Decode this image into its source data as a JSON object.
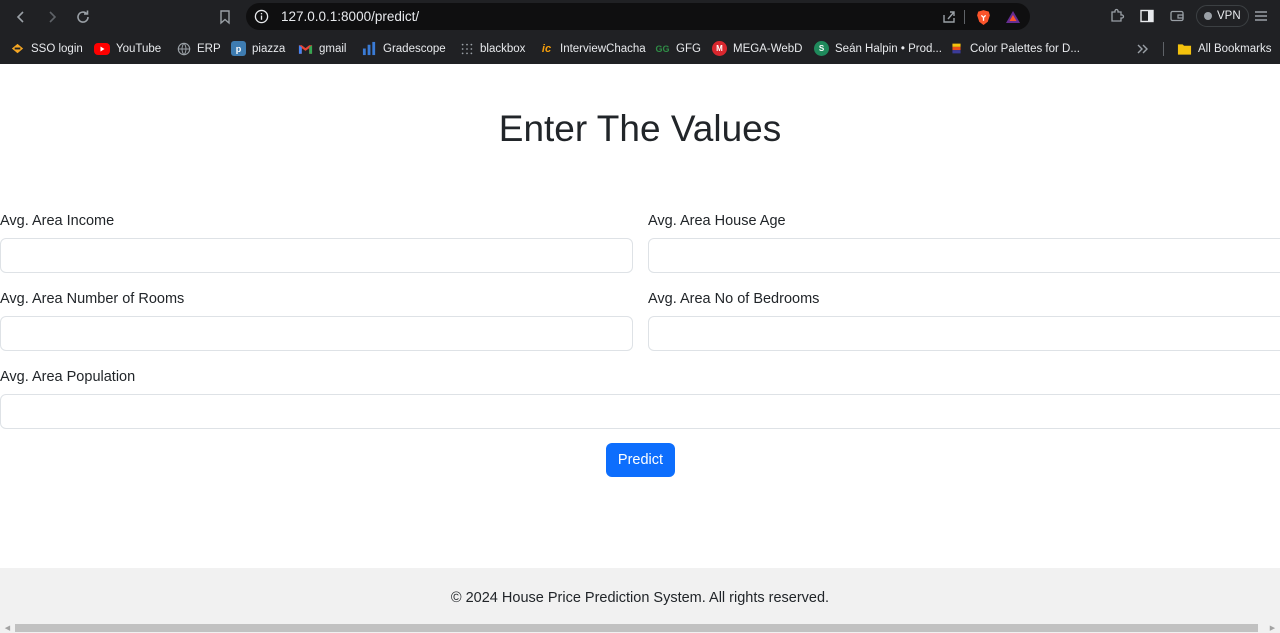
{
  "browser": {
    "url": "127.0.0.1:8000/predict/",
    "vpn_label": "VPN",
    "bookmarks": [
      {
        "label": "SSO login",
        "icon": "sso-icon",
        "color": "#f5a623"
      },
      {
        "label": "YouTube",
        "icon": "youtube-icon",
        "color": "#ff0000"
      },
      {
        "label": "ERP",
        "icon": "globe-icon",
        "color": "#9aa0a6"
      },
      {
        "label": "piazza",
        "icon": "piazza-icon",
        "color": "#3e7cb1"
      },
      {
        "label": "gmail",
        "icon": "gmail-icon",
        "color": "#ea4335"
      },
      {
        "label": "Gradescope",
        "icon": "gradescope-icon",
        "color": "#3a7bd5"
      },
      {
        "label": "blackbox",
        "icon": "blackbox-icon",
        "color": "#9aa0a6"
      },
      {
        "label": "InterviewChacha",
        "icon": "interviewchacha-icon",
        "color": "#f59e0b"
      },
      {
        "label": "GFG",
        "icon": "gfg-icon",
        "color": "#2f8d46"
      },
      {
        "label": "MEGA-WebD",
        "icon": "mega-icon",
        "color": "#d9272e"
      },
      {
        "label": "Seán Halpin • Prod...",
        "icon": "s-icon",
        "color": "#1f8a5c"
      },
      {
        "label": "Color Palettes for D...",
        "icon": "palette-icon",
        "color": "#f4c20d"
      }
    ],
    "all_bookmarks": "All Bookmarks"
  },
  "page": {
    "title": "Enter The Values",
    "fields": {
      "income": {
        "label": "Avg. Area Income",
        "value": ""
      },
      "house_age": {
        "label": "Avg. Area House Age",
        "value": ""
      },
      "rooms": {
        "label": "Avg. Area Number of Rooms",
        "value": ""
      },
      "bedrooms": {
        "label": "Avg. Area No of Bedrooms",
        "value": ""
      },
      "population": {
        "label": "Avg. Area Population",
        "value": ""
      }
    },
    "submit_label": "Predict",
    "footer": "© 2024 House Price Prediction System. All rights reserved."
  },
  "colors": {
    "primary": "#0d6efd",
    "footer_bg": "#f1f1f1",
    "chrome_bg": "#202124"
  }
}
